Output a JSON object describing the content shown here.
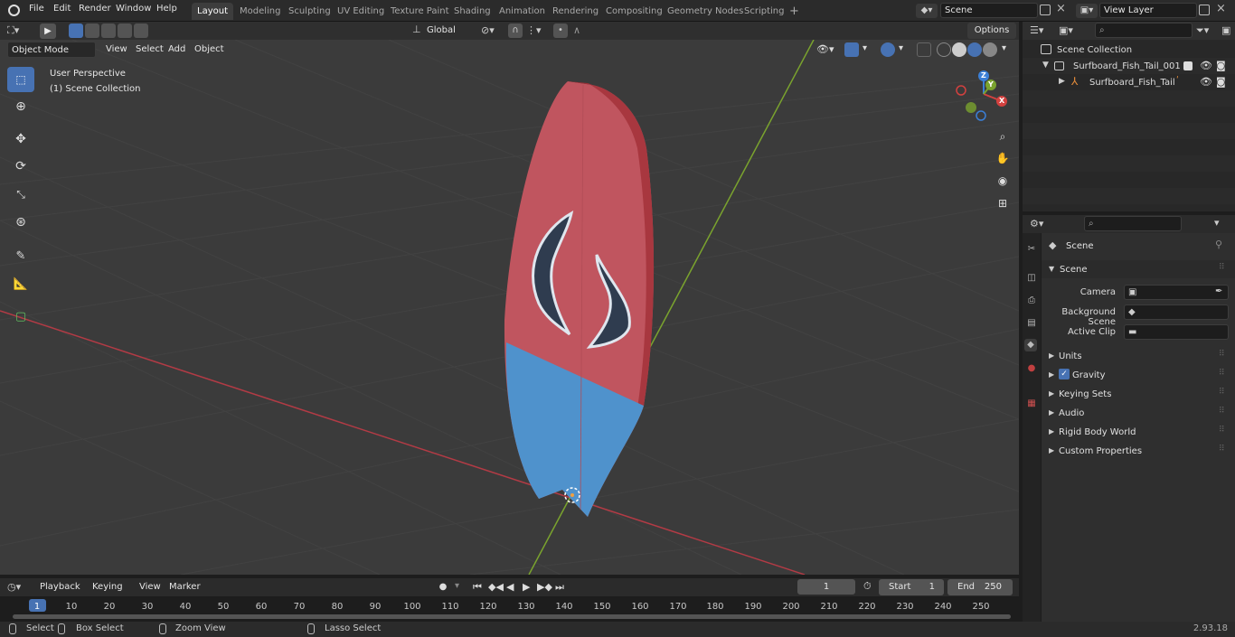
{
  "menus": [
    "File",
    "Edit",
    "Render",
    "Window",
    "Help"
  ],
  "workspaces": [
    {
      "label": "Layout",
      "active": true
    },
    {
      "label": "Modeling",
      "active": false
    },
    {
      "label": "Sculpting",
      "active": false
    },
    {
      "label": "UV Editing",
      "active": false
    },
    {
      "label": "Texture Paint",
      "active": false
    },
    {
      "label": "Shading",
      "active": false
    },
    {
      "label": "Animation",
      "active": false
    },
    {
      "label": "Rendering",
      "active": false
    },
    {
      "label": "Compositing",
      "active": false
    },
    {
      "label": "Geometry Nodes",
      "active": false
    },
    {
      "label": "Scripting",
      "active": false
    }
  ],
  "add_workspace": "+",
  "scene_field": "Scene",
  "view_layer_field": "View Layer",
  "viewport_header": {
    "mode": "Object Mode",
    "menus": [
      "View",
      "Select",
      "Add",
      "Object"
    ],
    "transform_orientation": "Global",
    "options": "Options"
  },
  "viewport_overlay": {
    "perspective": "User Perspective",
    "collection": "(1) Scene Collection"
  },
  "gizmo_axes": {
    "x": "X",
    "y": "Y",
    "z": "Z"
  },
  "outliner": {
    "root": "Scene Collection",
    "items": [
      {
        "label": "Surfboard_Fish_Tail_001"
      },
      {
        "label": "Surfboard_Fish_Tail"
      }
    ]
  },
  "properties": {
    "header": "Scene",
    "section": "Scene",
    "fields": [
      {
        "label": "Camera"
      },
      {
        "label": "Background Scene"
      },
      {
        "label": "Active Clip"
      }
    ],
    "panels": [
      "Units",
      "Gravity",
      "Keying Sets",
      "Audio",
      "Rigid Body World",
      "Custom Properties"
    ],
    "gravity_checked": true
  },
  "timeline": {
    "menus": [
      "Playback",
      "Keying",
      "View",
      "Marker"
    ],
    "current_frame": "1",
    "start_label": "Start",
    "start_value": "1",
    "end_label": "End",
    "end_value": "250",
    "ticks": [
      "1",
      "10",
      "20",
      "30",
      "40",
      "50",
      "60",
      "70",
      "80",
      "90",
      "100",
      "110",
      "120",
      "130",
      "140",
      "150",
      "160",
      "170",
      "180",
      "190",
      "200",
      "210",
      "220",
      "230",
      "240",
      "250"
    ]
  },
  "statusbar": {
    "select": "Select",
    "box_select": "Box Select",
    "zoom_view": "Zoom View",
    "lasso_select": "Lasso Select",
    "version": "2.93.18"
  },
  "colors": {
    "accent": "#4772b3",
    "board_top": "#c0555f",
    "board_bottom": "#4f92cc",
    "x_axis": "#b23b45",
    "y_axis": "#7aa32e"
  }
}
